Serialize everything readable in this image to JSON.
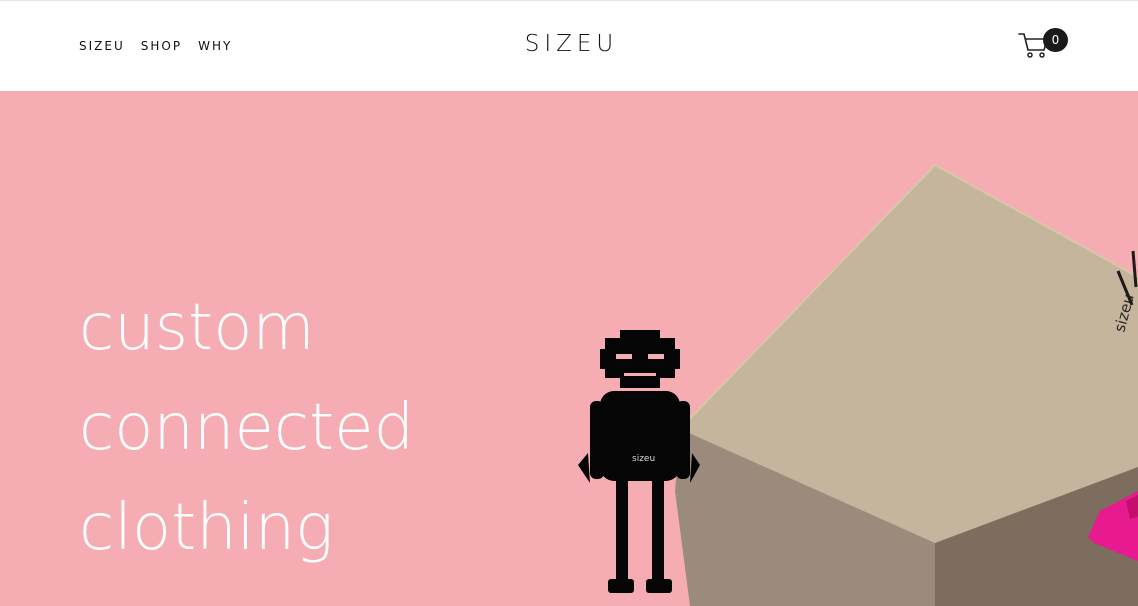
{
  "header": {
    "nav": [
      {
        "label": "SIZEU"
      },
      {
        "label": "SHOP"
      },
      {
        "label": "WHY"
      }
    ],
    "logo": "SIZEU",
    "cart_count": "0"
  },
  "hero": {
    "headline_lines": [
      "custom",
      "connected",
      "clothing"
    ],
    "box_print": "sizeu",
    "robot_chest_text": "sizeu"
  },
  "colors": {
    "hero_bg": "#f6acb3",
    "box_top": "#c4b59c",
    "box_front": "#9a8a7d",
    "box_side": "#7c6d5f",
    "accent_magenta": "#e81a8f"
  },
  "icons": [
    "cart-icon"
  ]
}
